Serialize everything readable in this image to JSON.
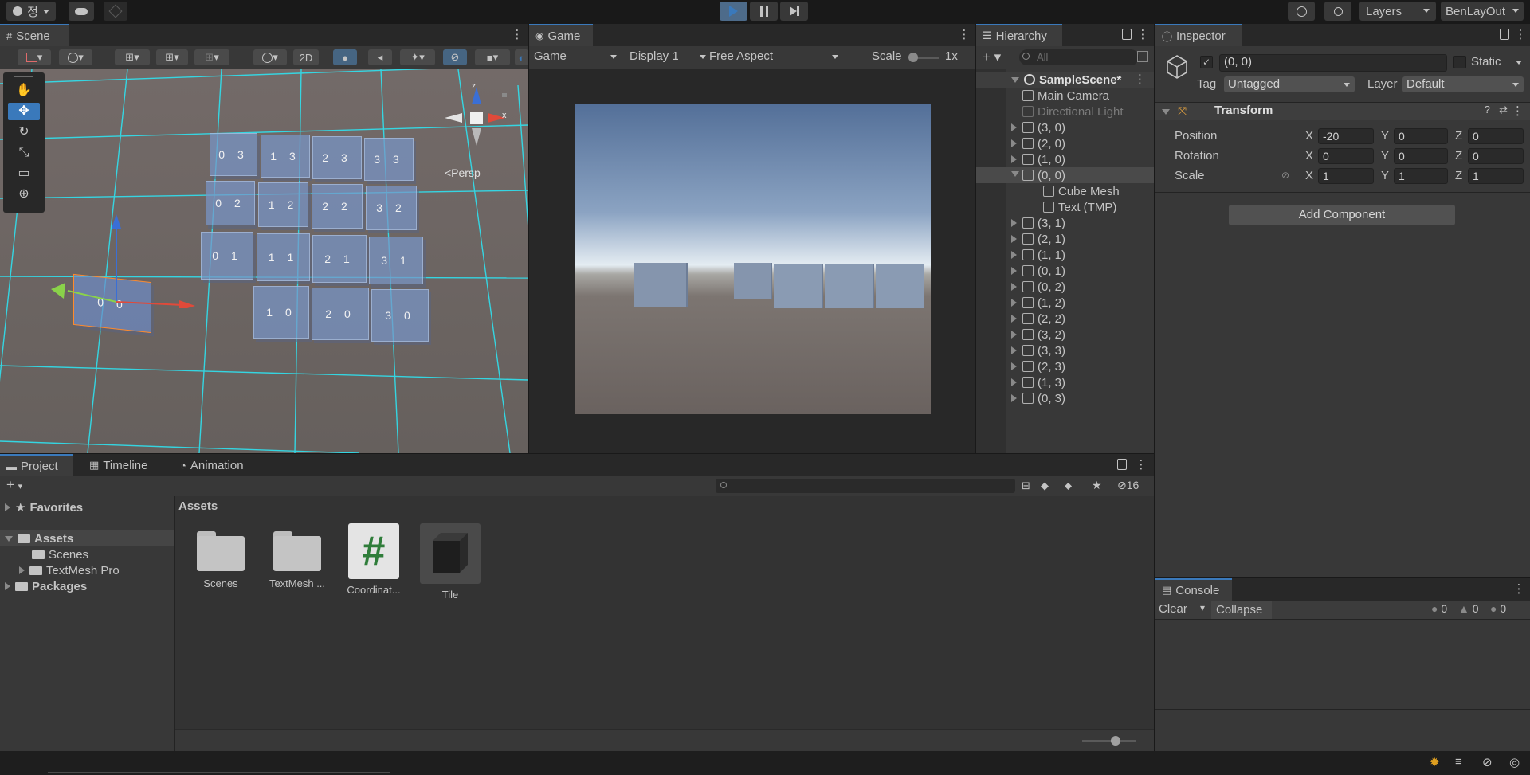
{
  "topbar": {
    "account_label": "정",
    "layers_label": "Layers",
    "layout_label": "BenLayOut"
  },
  "scene": {
    "tab_label": "Scene",
    "mode_2d": "2D",
    "persp_label": "<Persp",
    "gizmo_z": "z",
    "gizmo_x": "x",
    "cube_labels": [
      "0 3",
      "1 3",
      "2 3",
      "3 3",
      "0 2",
      "1 2",
      "2 2",
      "3 2",
      "0 1",
      "1 1",
      "2 1",
      "3 1",
      "1 0",
      "2 0",
      "3 0",
      "0 0"
    ]
  },
  "game": {
    "tab_label": "Game",
    "mode": "Game",
    "display": "Display 1",
    "aspect": "Free Aspect",
    "scale_label": "Scale",
    "scale_value": "1x"
  },
  "hierarchy": {
    "tab_label": "Hierarchy",
    "search_placeholder": "All",
    "scene_name": "SampleScene*",
    "items": [
      {
        "label": "Main Camera",
        "indent": 1,
        "expandable": false,
        "dim": false
      },
      {
        "label": "Directional Light",
        "indent": 1,
        "expandable": false,
        "dim": true
      },
      {
        "label": "(3, 0)",
        "indent": 1,
        "expandable": true
      },
      {
        "label": "(2, 0)",
        "indent": 1,
        "expandable": true
      },
      {
        "label": "(1, 0)",
        "indent": 1,
        "expandable": true
      },
      {
        "label": "(0, 0)",
        "indent": 1,
        "expandable": true,
        "expanded": true,
        "selected": true
      },
      {
        "label": "Cube Mesh",
        "indent": 2,
        "expandable": false
      },
      {
        "label": "Text (TMP)",
        "indent": 2,
        "expandable": false
      },
      {
        "label": "(3, 1)",
        "indent": 1,
        "expandable": true
      },
      {
        "label": "(2, 1)",
        "indent": 1,
        "expandable": true
      },
      {
        "label": "(1, 1)",
        "indent": 1,
        "expandable": true
      },
      {
        "label": "(0, 1)",
        "indent": 1,
        "expandable": true
      },
      {
        "label": "(0, 2)",
        "indent": 1,
        "expandable": true
      },
      {
        "label": "(1, 2)",
        "indent": 1,
        "expandable": true
      },
      {
        "label": "(2, 2)",
        "indent": 1,
        "expandable": true
      },
      {
        "label": "(3, 2)",
        "indent": 1,
        "expandable": true
      },
      {
        "label": "(3, 3)",
        "indent": 1,
        "expandable": true
      },
      {
        "label": "(2, 3)",
        "indent": 1,
        "expandable": true
      },
      {
        "label": "(1, 3)",
        "indent": 1,
        "expandable": true
      },
      {
        "label": "(0, 3)",
        "indent": 1,
        "expandable": true
      }
    ]
  },
  "inspector": {
    "tab_label": "Inspector",
    "object_name": "(0, 0)",
    "static_label": "Static",
    "tag_label": "Tag",
    "tag_value": "Untagged",
    "layer_label": "Layer",
    "layer_value": "Default",
    "transform_label": "Transform",
    "position_label": "Position",
    "rotation_label": "Rotation",
    "scale_label": "Scale",
    "x": "X",
    "y": "Y",
    "z": "Z",
    "position": [
      "-20",
      "0",
      "0"
    ],
    "rotation": [
      "0",
      "0",
      "0"
    ],
    "scale": [
      "1",
      "1",
      "1"
    ],
    "add_component": "Add Component"
  },
  "console": {
    "tab_label": "Console",
    "clear_label": "Clear",
    "collapse_label": "Collapse",
    "log_count": "0",
    "warn_count": "0",
    "error_count": "0"
  },
  "project": {
    "tabs": [
      "Project",
      "Timeline",
      "Animation"
    ],
    "hidden_count": "16",
    "favorites": "Favorites",
    "assets": "Assets",
    "scenes": "Scenes",
    "textmesh": "TextMesh Pro",
    "packages": "Packages",
    "breadcrumb": "Assets",
    "asset_items": [
      "Scenes",
      "TextMesh ...",
      "Coordinat...",
      "Tile"
    ]
  },
  "colors": {
    "accent": "#3a79bb",
    "panel": "#383838",
    "selected": "#2c5d87"
  }
}
